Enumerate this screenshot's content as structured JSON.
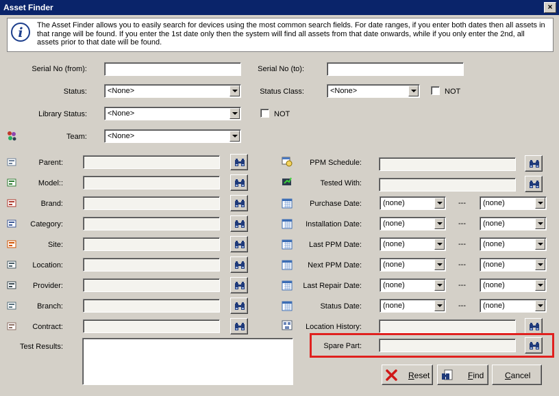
{
  "window": {
    "title": "Asset Finder",
    "close": "×"
  },
  "info": {
    "text": "The Asset Finder allows you to easily search for devices using the most common search fields. For date ranges, if you enter both dates then all assets in that range will be found. If you enter the 1st date only then the system will find all assets from that date onwards, while if you only enter the 2nd, all assets prior to that date will be found."
  },
  "top": {
    "serial_from": "Serial No (from):",
    "serial_to": "Serial No (to):",
    "status": "Status:",
    "status_value": "<None>",
    "status_class": "Status Class:",
    "status_class_value": "<None>",
    "not1": "NOT",
    "library_status": "Library Status:",
    "library_status_value": "<None>",
    "not2": "NOT",
    "team": "Team:",
    "team_value": "<None>"
  },
  "left_fields": [
    {
      "label": "Parent:",
      "icon": "parent-icon"
    },
    {
      "label": "Model::",
      "icon": "model-icon"
    },
    {
      "label": "Brand:",
      "icon": "brand-icon"
    },
    {
      "label": "Category:",
      "icon": "category-icon"
    },
    {
      "label": "Site:",
      "icon": "site-icon"
    },
    {
      "label": "Location:",
      "icon": "location-icon"
    },
    {
      "label": "Provider:",
      "icon": "provider-icon"
    },
    {
      "label": "Branch:",
      "icon": "branch-icon"
    },
    {
      "label": "Contract:",
      "icon": "contract-icon"
    }
  ],
  "right": {
    "ppm_schedule": "PPM Schedule:",
    "tested_with": "Tested With:",
    "dates": [
      {
        "label": "Purchase Date:",
        "from": "(none)",
        "to": "(none)"
      },
      {
        "label": "Installation Date:",
        "from": "(none)",
        "to": "(none)"
      },
      {
        "label": "Last PPM Date:",
        "from": "(none)",
        "to": "(none)"
      },
      {
        "label": "Next PPM Date:",
        "from": "(none)",
        "to": "(none)"
      },
      {
        "label": "Last Repair Date:",
        "from": "(none)",
        "to": "(none)"
      },
      {
        "label": "Status Date:",
        "from": "(none)",
        "to": "(none)"
      }
    ],
    "dash": "---",
    "location_history": "Location History:",
    "spare_part": "Spare Part:"
  },
  "test_results": "Test Results:",
  "buttons": {
    "reset": "Reset",
    "find": "Find",
    "cancel": "Cancel"
  },
  "colors": {
    "titlebar": "#0a246a",
    "highlight": "#e0201e",
    "face": "#d4d0c8"
  }
}
